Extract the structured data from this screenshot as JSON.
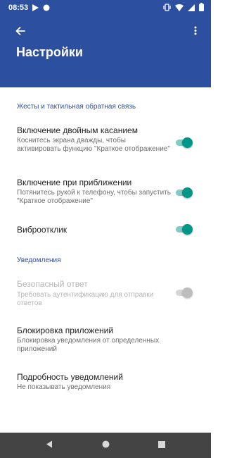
{
  "status_bar": {
    "time": "08:53",
    "left_icons": [
      "play-store-icon",
      "circle-notification-icon"
    ],
    "right_icons": [
      "vibrate-icon",
      "wifi-icon",
      "signal-icon",
      "battery-icon"
    ]
  },
  "app_bar": {
    "title": "Настройки",
    "background_color": "#2c4fa0"
  },
  "sections": [
    {
      "header": "Жесты и тактильная обратная связь",
      "items": [
        {
          "title": "Включение двойным касанием",
          "summary": "Коснитесь экрана дважды, чтобы активировать функцию \"Краткое отображение\"",
          "switch": true,
          "enabled": true
        },
        {
          "title": "Включение при приближении",
          "summary": "Потянитесь рукой к телефону, чтобы запустить \"Краткое отображение\"",
          "switch": true,
          "enabled": true
        },
        {
          "title": "Виброотклик",
          "switch": true,
          "enabled": true
        }
      ]
    },
    {
      "header": "Уведомления",
      "items": [
        {
          "title": "Безопасный ответ",
          "summary": "Требовать аутентификацию для отправки ответов",
          "switch": false,
          "enabled": false
        },
        {
          "title": "Блокировка приложений",
          "summary": "Блокировка уведомления от определенных приложений"
        },
        {
          "title": "Подробность уведомлений",
          "summary": "Не показывать уведомления"
        }
      ]
    }
  ],
  "colors": {
    "accent": "#009688",
    "section_header": "#2c4fa0",
    "nav_bar": "#444444"
  },
  "nav_bar": {
    "buttons": [
      "back-icon",
      "home-icon",
      "recents-icon"
    ]
  }
}
